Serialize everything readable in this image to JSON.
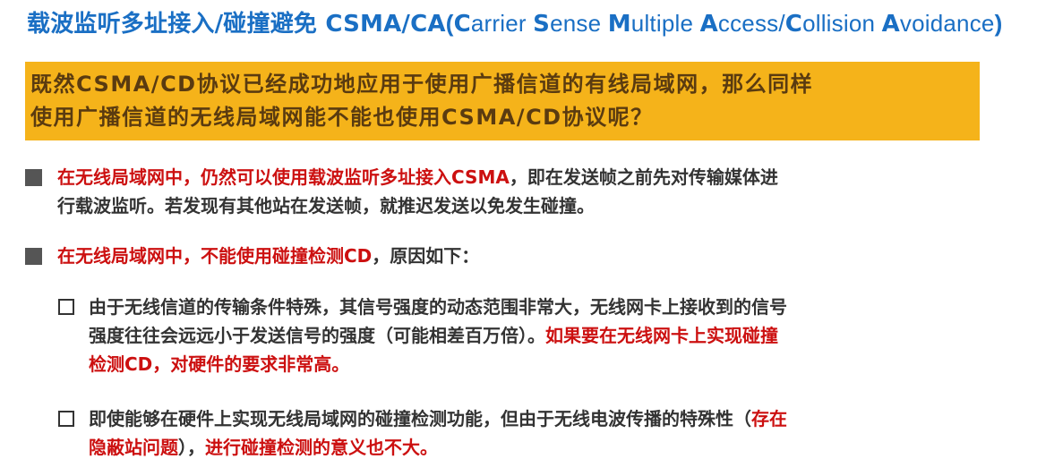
{
  "title": {
    "main": "载波监听多址接入/碰撞避免 CSMA/CA",
    "open": "(",
    "w1_cap": "C",
    "w1_rest": "arrier ",
    "w2_cap": "S",
    "w2_rest": "ense ",
    "w3_cap": "M",
    "w3_rest": "ultiple ",
    "w4_cap": "A",
    "w4_rest": "ccess/",
    "w5_cap": "C",
    "w5_rest": "ollision ",
    "w6_cap": "A",
    "w6_rest": "voidance",
    "close": ")"
  },
  "question": {
    "line1": "既然CSMA/CD协议已经成功地应用于使用广播信道的有线局域网，那么同样",
    "line2": "使用广播信道的无线局域网能不能也使用CSMA/CD协议呢？"
  },
  "bullet1": {
    "red": "在无线局域网中，仍然可以使用载波监听多址接入CSMA",
    "rest1": "，即在发送帧之前先对传输媒体进",
    "line2": "行载波监听。若发现有其他站在发送帧，就推迟发送以免发生碰撞。"
  },
  "bullet2": {
    "red": "在无线局域网中，不能使用碰撞检测CD",
    "rest": "，原因如下："
  },
  "sub1": {
    "line1": "由于无线信道的传输条件特殊，其信号强度的动态范围非常大，无线网卡上接收到的信号",
    "line2_plain": "强度往往会远远小于发送信号的强度（可能相差百万倍）。",
    "line2_red": "如果要在无线网卡上实现碰撞",
    "line3_red": "检测CD，对硬件的要求非常高。"
  },
  "sub2": {
    "line1_plain": "即使能够在硬件上实现无线局域网的碰撞检测功能，但由于无线电波传播的特殊性（",
    "line1_red": "存在",
    "line2_red1": "隐蔽站问题",
    "line2_plain": "），",
    "line2_red2": "进行碰撞检测的意义也不大。"
  }
}
